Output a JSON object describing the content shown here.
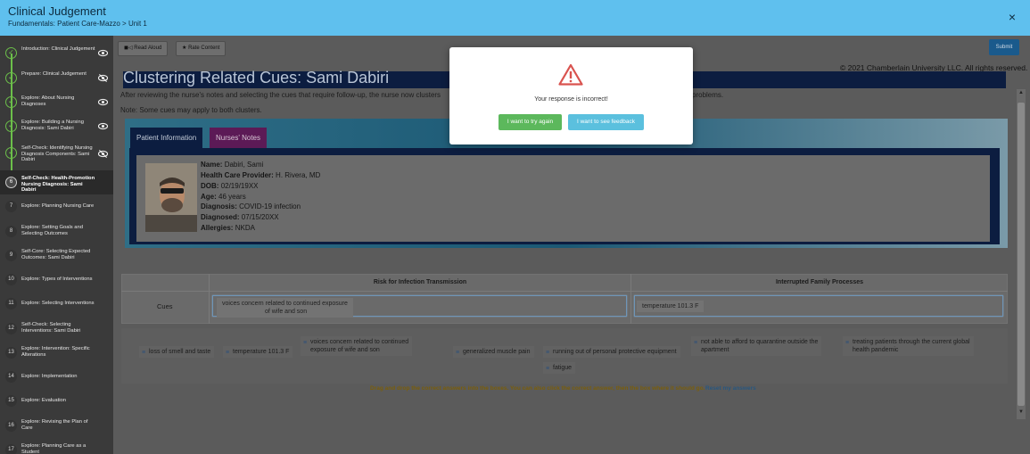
{
  "header": {
    "title": "Clinical Judgement",
    "breadcrumb": "Fundamentals: Patient Care-Mazzo > Unit 1",
    "close_icon": "×"
  },
  "sidebar": {
    "items": [
      {
        "label": "Introduction: Clinical Judgement",
        "state": "complete",
        "icon": "eye-icon"
      },
      {
        "label": "Prepare: Clinical Judgement",
        "state": "complete",
        "icon": "eye-slash-icon"
      },
      {
        "label": "Explore: About Nursing Diagnoses",
        "state": "complete",
        "icon": "eye-icon"
      },
      {
        "label": "Explore: Building a Nursing Diagnosis: Sami Dabiri",
        "state": "complete",
        "icon": "eye-icon"
      },
      {
        "label": "Self-Check: Identifying Nursing Diagnosis Components: Sami Dabiri",
        "state": "complete",
        "icon": "eye-slash-icon"
      },
      {
        "label": "Self-Check: Health-Promotion Nursing Diagnosis: Sami Dabiri",
        "state": "current",
        "num": "6"
      },
      {
        "label": "Explore: Planning Nursing Care",
        "num": "7"
      },
      {
        "label": "Explore: Setting Goals and Selecting Outcomes",
        "num": "8"
      },
      {
        "label": "Self-Core: Selecting Expected Outcomes: Sami Dabiri",
        "num": "9"
      },
      {
        "label": "Explore: Types of Interventions",
        "num": "10"
      },
      {
        "label": "Explore: Selecting Interventions",
        "num": "11"
      },
      {
        "label": "Self-Check: Selecting Interventions: Sami Dabiri",
        "num": "12"
      },
      {
        "label": "Explore: Intervention: Specific Alterations",
        "num": "13"
      },
      {
        "label": "Explore: Implementation",
        "num": "14"
      },
      {
        "label": "Explore: Evaluation",
        "num": "15"
      },
      {
        "label": "Explore: Revising the Plan of Care",
        "num": "16"
      },
      {
        "label": "Explore: Planning Care as a Student",
        "num": "17"
      }
    ]
  },
  "toolbar": {
    "read_aloud": "Read Aloud",
    "rate_content": "Rate Content",
    "submit": "Submit"
  },
  "content": {
    "copyright": "© 2021 Chamberlain University LLC. All rights reserved.",
    "title": "Clustering Related Cues: Sami Dabiri",
    "instructions": "After reviewing the nurse's notes and selecting the cues that require follow-up, the nurse now clusters",
    "instructions_tail": "problems.",
    "note": "Note: Some cues may apply to both clusters."
  },
  "patient": {
    "tabs": [
      "Patient Information",
      "Nurses' Notes"
    ],
    "fields": [
      {
        "label": "Name:",
        "value": "Dabiri, Sami"
      },
      {
        "label": "Health Care Provider:",
        "value": "H. Rivera, MD"
      },
      {
        "label": "DOB:",
        "value": "02/19/19XX"
      },
      {
        "label": "Age:",
        "value": "46 years"
      },
      {
        "label": "Diagnosis:",
        "value": "COVID-19 infection"
      },
      {
        "label": "Diagnosed:",
        "value": "07/15/20XX"
      },
      {
        "label": "Allergies:",
        "value": "NKDA"
      }
    ]
  },
  "table": {
    "col1": "Risk for Infection Transmission",
    "col2": "Interrupted Family Processes",
    "row_label": "Cues",
    "drop1_line1": "voices concern related to continued exposure",
    "drop1_line2": "of wife and son",
    "drop2": "temperature 101.3 F"
  },
  "chips": [
    {
      "text": "loss of smell and taste"
    },
    {
      "text": "temperature 101.3 F"
    },
    {
      "line1": "voices concern related to continued",
      "line2": "exposure of wife and son"
    },
    {
      "text": "generalized muscle pain"
    },
    {
      "text": "running out of personal protective equipment"
    },
    {
      "line1": "not able to afford to quarantine outside the",
      "line2": "apartment"
    },
    {
      "line1": "treating patients through the current global",
      "line2": "health pandemic"
    },
    {
      "text": "fatigue"
    }
  ],
  "drag_instructions": "Drag and drop the correct answers into the boxes. You can also click the correct answer, then the box where it should go.",
  "reset_link": "Reset my answers",
  "modal": {
    "icon": "warning-triangle-icon",
    "message": "Your response is incorrect!",
    "retry": "I want to try again",
    "feedback": "I want to see feedback",
    "retry_color": "#5cb85c",
    "feedback_color": "#5bc0de",
    "icon_color": "#d9534f"
  }
}
